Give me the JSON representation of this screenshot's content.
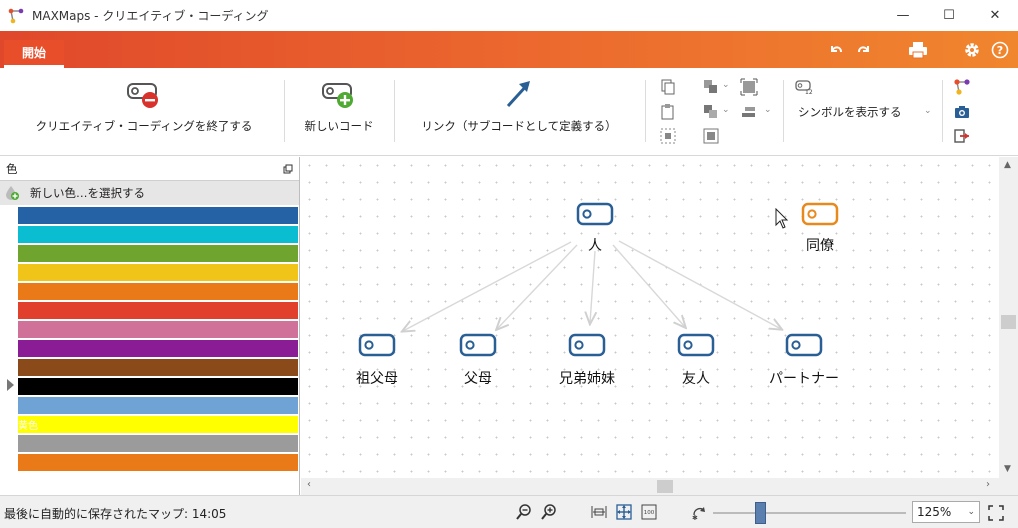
{
  "window": {
    "title": "MAXMaps - クリエイティブ・コーディング",
    "minimize": "—",
    "maximize": "☐",
    "close": "✕"
  },
  "ribbon": {
    "active_tab": "開始",
    "end_creative_label": "クリエイティブ・コーディングを終了する",
    "new_code_label": "新しいコード",
    "link_label": "リンク（サブコードとして定義する）",
    "show_symbols_label": "シンボルを表示する"
  },
  "panel": {
    "title": "色",
    "new_color_label": "新しい色…を選択する",
    "swatches": [
      {
        "color": "#2461a5",
        "label": ""
      },
      {
        "color": "#0bbdd0",
        "label": ""
      },
      {
        "color": "#6fa52e",
        "label": ""
      },
      {
        "color": "#f1c419",
        "label": ""
      },
      {
        "color": "#ea7a18",
        "label": ""
      },
      {
        "color": "#e0402c",
        "label": ""
      },
      {
        "color": "#cf7199",
        "label": ""
      },
      {
        "color": "#8a1d96",
        "label": ""
      },
      {
        "color": "#8b4a1a",
        "label": ""
      },
      {
        "color": "#000000",
        "label": ""
      },
      {
        "color": "#6fa3d5",
        "label": ""
      },
      {
        "color": "#ffff00",
        "label": "黄色"
      },
      {
        "color": "#9b9b9b",
        "label": ""
      },
      {
        "color": "#ea7a18",
        "label": ""
      }
    ]
  },
  "map": {
    "nodes": [
      {
        "id": "person",
        "label": "人",
        "color": "#2a5f96"
      },
      {
        "id": "colleague",
        "label": "同僚",
        "color": "#e8891e"
      },
      {
        "id": "grandparents",
        "label": "祖父母",
        "color": "#2a5f96"
      },
      {
        "id": "parents",
        "label": "父母",
        "color": "#2a5f96"
      },
      {
        "id": "siblings",
        "label": "兄弟姉妹",
        "color": "#2a5f96"
      },
      {
        "id": "friend",
        "label": "友人",
        "color": "#2a5f96"
      },
      {
        "id": "partner",
        "label": "パートナー",
        "color": "#2a5f96"
      }
    ]
  },
  "status": {
    "autosave_text": "最後に自動的に保存されたマップ: 14:05",
    "zoom_value": "125%"
  },
  "colors": {
    "accent": "#e94e2b",
    "code_blue": "#2a5f96",
    "code_orange": "#e8891e"
  }
}
